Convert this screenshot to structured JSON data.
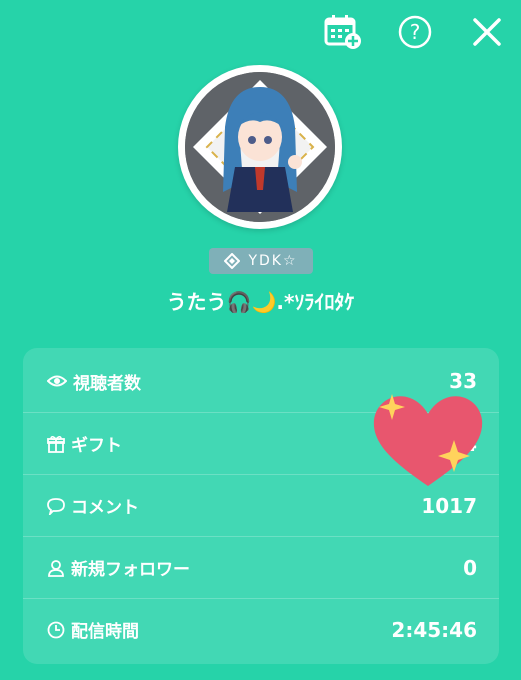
{
  "header": {
    "calendar_icon": "calendar-add-icon",
    "help_icon": "help-icon",
    "close_icon": "close-icon"
  },
  "profile": {
    "badge": "YDK☆",
    "username": "うたう🎧🌙.*ｿﾗｲﾛﾀｹ"
  },
  "stats": [
    {
      "icon": "eye-icon",
      "label": "視聴者数",
      "value": "33"
    },
    {
      "icon": "gift-icon",
      "label": "ギフト",
      "value": "4"
    },
    {
      "icon": "comment-icon",
      "label": "コメント",
      "value": "1017"
    },
    {
      "icon": "user-icon",
      "label": "新規フォロワー",
      "value": "0"
    },
    {
      "icon": "clock-icon",
      "label": "配信時間",
      "value": "2:45:46"
    }
  ],
  "colors": {
    "background": "#26d3a9",
    "heart": "#e8566e",
    "sparkle": "#ffd35c"
  }
}
